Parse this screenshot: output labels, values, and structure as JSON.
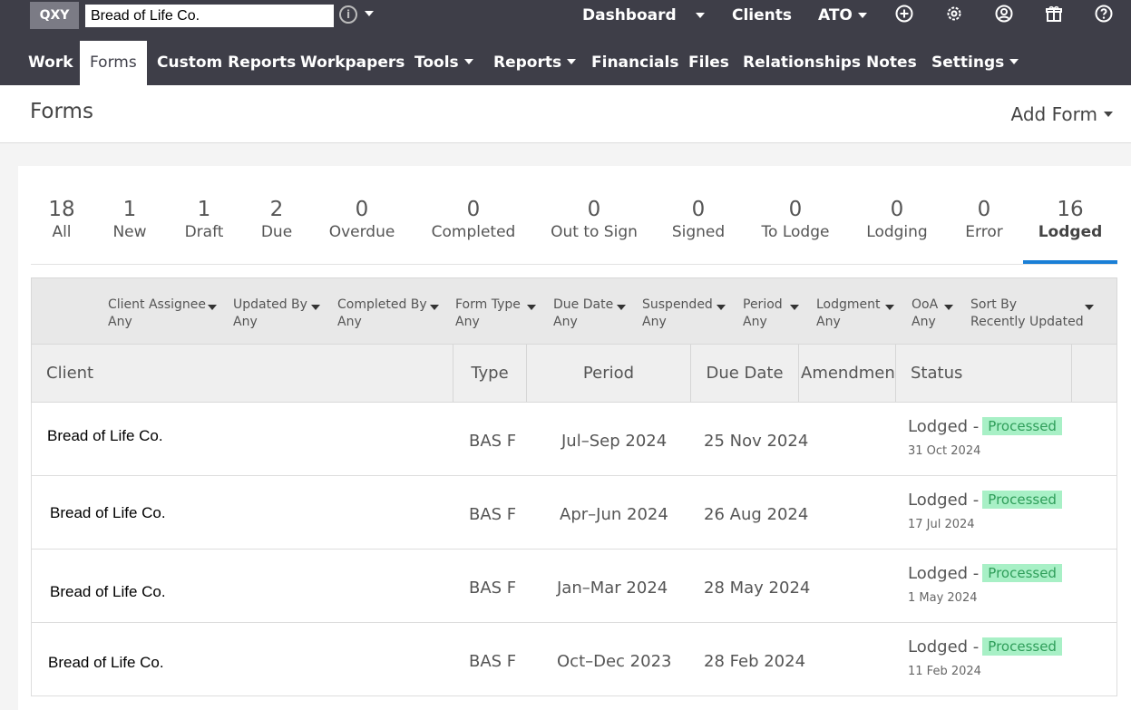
{
  "topbar": {
    "badge": "QXY",
    "client_value": "Bread of Life Co.",
    "links": {
      "dashboard": "Dashboard",
      "clients": "Clients",
      "ato": "ATO"
    }
  },
  "nav": [
    {
      "label": "Work"
    },
    {
      "label": "Forms"
    },
    {
      "label": "Custom Reports"
    },
    {
      "label": "Workpapers"
    },
    {
      "label": "Tools"
    },
    {
      "label": "Reports"
    },
    {
      "label": "Financials"
    },
    {
      "label": "Files"
    },
    {
      "label": "Relationships"
    },
    {
      "label": "Notes"
    },
    {
      "label": "Settings"
    }
  ],
  "page": {
    "title": "Forms",
    "add_form": "Add Form"
  },
  "stats": [
    {
      "num": "18",
      "label": "All"
    },
    {
      "num": "1",
      "label": "New"
    },
    {
      "num": "1",
      "label": "Draft"
    },
    {
      "num": "2",
      "label": "Due"
    },
    {
      "num": "0",
      "label": "Overdue"
    },
    {
      "num": "0",
      "label": "Completed"
    },
    {
      "num": "0",
      "label": "Out to Sign"
    },
    {
      "num": "0",
      "label": "Signed"
    },
    {
      "num": "0",
      "label": "To Lodge"
    },
    {
      "num": "0",
      "label": "Lodging"
    },
    {
      "num": "0",
      "label": "Error"
    },
    {
      "num": "16",
      "label": "Lodged"
    }
  ],
  "filters": [
    {
      "label": "Client Assignee",
      "value": "Any"
    },
    {
      "label": "Updated By",
      "value": "Any"
    },
    {
      "label": "Completed By",
      "value": "Any"
    },
    {
      "label": "Form Type",
      "value": "Any"
    },
    {
      "label": "Due Date",
      "value": "Any"
    },
    {
      "label": "Suspended",
      "value": "Any"
    },
    {
      "label": "Period",
      "value": "Any"
    },
    {
      "label": "Lodgment",
      "value": "Any"
    },
    {
      "label": "OoA",
      "value": "Any"
    },
    {
      "label": "Sort By",
      "value": "Recently Updated"
    }
  ],
  "columns": {
    "client": "Client",
    "type": "Type",
    "period": "Period",
    "due_date": "Due Date",
    "amendment": "Amendment",
    "status": "Status"
  },
  "rows": [
    {
      "client": "Bread of Life Co.",
      "type": "BAS F",
      "period": "Jul–Sep 2024",
      "due": "25 Nov 2024",
      "status": "Lodged -",
      "badge": "Processed",
      "date": "31 Oct 2024"
    },
    {
      "client": "Bread of Life Co.",
      "type": "BAS F",
      "period": "Apr–Jun 2024",
      "due": "26 Aug 2024",
      "status": "Lodged -",
      "badge": "Processed",
      "date": "17 Jul 2024"
    },
    {
      "client": "Bread of Life Co.",
      "type": "BAS F",
      "period": "Jan–Mar 2024",
      "due": "28 May 2024",
      "status": "Lodged -",
      "badge": "Processed",
      "date": "1 May 2024"
    },
    {
      "client": "Bread of Life Co.",
      "type": "BAS F",
      "period": "Oct–Dec 2023",
      "due": "28 Feb 2024",
      "status": "Lodged -",
      "badge": "Processed",
      "date": "11 Feb 2024"
    }
  ],
  "colors": {
    "topbar": "#3e3e48",
    "active_tab_underline": "#1a7fd6",
    "processed_bg": "#a8f0c6",
    "processed_text": "#2f9e5a"
  }
}
